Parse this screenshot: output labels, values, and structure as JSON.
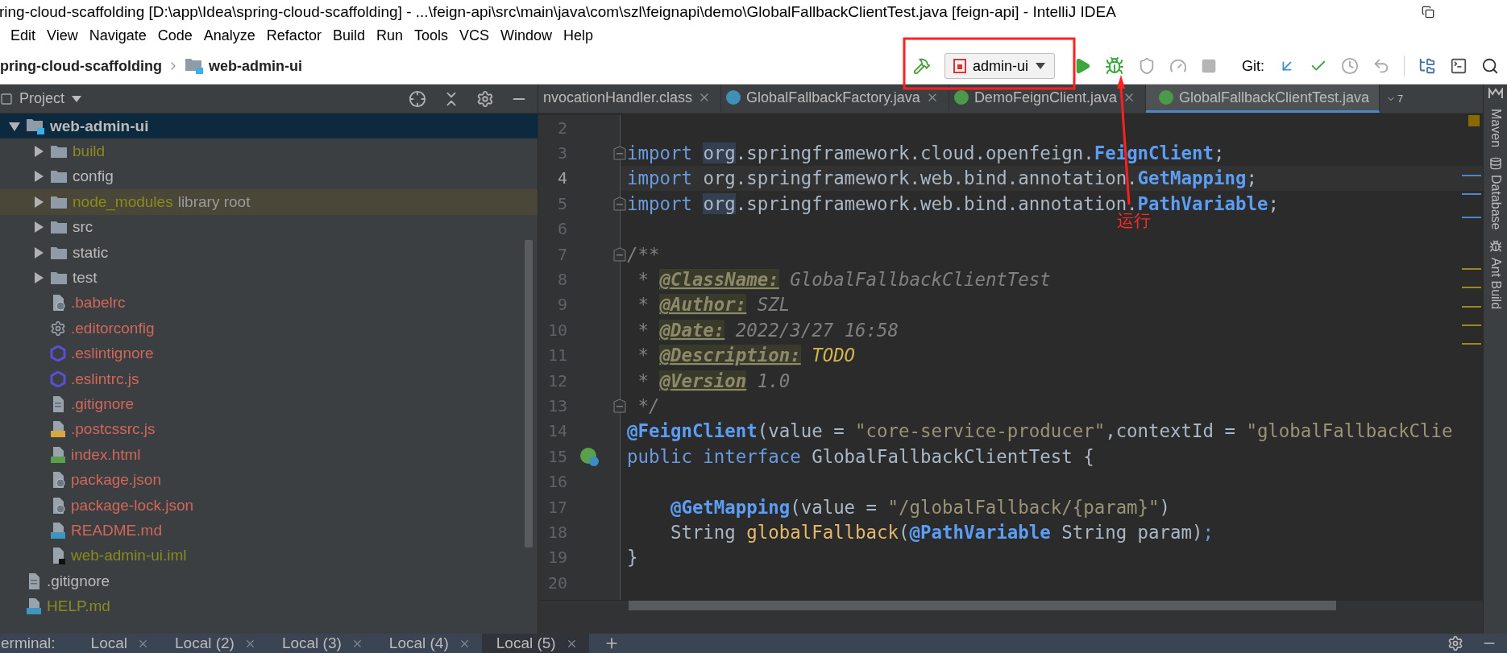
{
  "window": {
    "title": "ring-cloud-scaffolding [D:\\app\\Idea\\spring-cloud-scaffolding] - ...\\feign-api\\src\\main\\java\\com\\szl\\feignapi\\demo\\GlobalFallbackClientTest.java [feign-api] - IntelliJ IDEA"
  },
  "menu": [
    "Edit",
    "View",
    "Navigate",
    "Code",
    "Analyze",
    "Refactor",
    "Build",
    "Run",
    "Tools",
    "VCS",
    "Window",
    "Help"
  ],
  "breadcrumbs": [
    "pring-cloud-scaffolding",
    "web-admin-ui"
  ],
  "run_config": {
    "label": "admin-ui"
  },
  "git_label": "Git:",
  "project_panel": {
    "title": "Project"
  },
  "tree": [
    {
      "label": "web-admin-ui",
      "kind": "module",
      "expanded": true,
      "selected": true,
      "highlighted": false,
      "ignored": false,
      "unversioned": false,
      "children": [
        {
          "label": "build",
          "kind": "folder",
          "expanded": false,
          "selected": false,
          "highlighted": false,
          "ignored": true,
          "unversioned": false
        },
        {
          "label": "config",
          "kind": "folder",
          "expanded": false,
          "selected": false,
          "highlighted": false,
          "ignored": false,
          "unversioned": false
        },
        {
          "label": "node_modules",
          "kind": "folder",
          "expanded": false,
          "selected": false,
          "highlighted": true,
          "ignored": true,
          "unversioned": false,
          "note": "library root"
        },
        {
          "label": "src",
          "kind": "folder",
          "expanded": false,
          "selected": false,
          "highlighted": false,
          "ignored": false,
          "unversioned": false
        },
        {
          "label": "static",
          "kind": "folder",
          "expanded": false,
          "selected": false,
          "highlighted": false,
          "ignored": false,
          "unversioned": false
        },
        {
          "label": "test",
          "kind": "folder",
          "expanded": false,
          "selected": false,
          "highlighted": false,
          "ignored": false,
          "unversioned": false
        },
        {
          "label": ".babelrc",
          "kind": "json",
          "selected": false,
          "highlighted": false,
          "ignored": false,
          "unversioned": true
        },
        {
          "label": ".editorconfig",
          "kind": "config",
          "selected": false,
          "highlighted": false,
          "ignored": false,
          "unversioned": true
        },
        {
          "label": ".eslintignore",
          "kind": "eslint",
          "selected": false,
          "highlighted": false,
          "ignored": false,
          "unversioned": true
        },
        {
          "label": ".eslintrc.js",
          "kind": "eslint",
          "selected": false,
          "highlighted": false,
          "ignored": false,
          "unversioned": true
        },
        {
          "label": ".gitignore",
          "kind": "text",
          "selected": false,
          "highlighted": false,
          "ignored": false,
          "unversioned": true
        },
        {
          "label": ".postcssrc.js",
          "kind": "js",
          "selected": false,
          "highlighted": false,
          "ignored": false,
          "unversioned": true
        },
        {
          "label": "index.html",
          "kind": "html",
          "selected": false,
          "highlighted": false,
          "ignored": false,
          "unversioned": true
        },
        {
          "label": "package.json",
          "kind": "json",
          "selected": false,
          "highlighted": false,
          "ignored": false,
          "unversioned": true
        },
        {
          "label": "package-lock.json",
          "kind": "json",
          "selected": false,
          "highlighted": false,
          "ignored": false,
          "unversioned": true
        },
        {
          "label": "README.md",
          "kind": "md",
          "selected": false,
          "highlighted": false,
          "ignored": false,
          "unversioned": true
        },
        {
          "label": "web-admin-ui.iml",
          "kind": "iml",
          "selected": false,
          "highlighted": false,
          "ignored": true,
          "unversioned": false
        }
      ]
    },
    {
      "label": ".gitignore",
      "kind": "text",
      "selected": false,
      "highlighted": false,
      "ignored": false,
      "unversioned": false
    },
    {
      "label": "HELP.md",
      "kind": "md",
      "selected": false,
      "highlighted": false,
      "ignored": true,
      "unversioned": false
    }
  ],
  "editor_tabs": [
    {
      "label": "nvocationHandler.class",
      "kind": "plain",
      "selected": false,
      "closable": true
    },
    {
      "label": "GlobalFallbackFactory.java",
      "kind": "class",
      "selected": false,
      "closable": true
    },
    {
      "label": "DemoFeignClient.java",
      "kind": "interface",
      "selected": false,
      "closable": true
    },
    {
      "label": "GlobalFallbackClientTest.java",
      "kind": "interface",
      "selected": true,
      "closable": false
    }
  ],
  "tabs_overflow": "7",
  "code_lines": [
    {
      "number": "2",
      "current": false,
      "fold": false,
      "gutter_icon": false
    },
    {
      "number": "3",
      "current": false,
      "fold": true,
      "gutter_icon": false,
      "tokens": [
        {
          "kind": "keyword",
          "text": "import "
        },
        {
          "kind": "reference",
          "text": "org"
        },
        {
          "kind": "plain",
          "text": ".springframework.cloud.openfeign."
        },
        {
          "kind": "annotation",
          "text": "FeignClient"
        },
        {
          "kind": "plain",
          "text": ";"
        }
      ]
    },
    {
      "number": "4",
      "current": true,
      "fold": false,
      "gutter_icon": false,
      "tokens": [
        {
          "kind": "keyword",
          "text": "import "
        },
        {
          "kind": "plain",
          "text": "org.springframework.web.bind.annotation."
        },
        {
          "kind": "annotation",
          "text": "GetMapping"
        },
        {
          "kind": "plain",
          "text": ";"
        }
      ]
    },
    {
      "number": "5",
      "current": false,
      "fold": true,
      "gutter_icon": false,
      "tokens": [
        {
          "kind": "keyword",
          "text": "import "
        },
        {
          "kind": "reference",
          "text": "org"
        },
        {
          "kind": "plain",
          "text": ".springframework.web.bind.annotation."
        },
        {
          "kind": "annotation",
          "text": "PathVariable"
        },
        {
          "kind": "plain",
          "text": ";"
        }
      ]
    },
    {
      "number": "6",
      "current": false,
      "fold": false,
      "gutter_icon": false
    },
    {
      "number": "7",
      "current": false,
      "fold": true,
      "gutter_icon": false,
      "tokens": [
        {
          "kind": "comment",
          "text": "/**"
        }
      ]
    },
    {
      "number": "8",
      "current": false,
      "fold": false,
      "gutter_icon": false,
      "tokens": [
        {
          "kind": "comment",
          "text": " * "
        },
        {
          "kind": "doctag",
          "text": "@ClassName:"
        },
        {
          "kind": "comment",
          "text": " GlobalFallbackClientTest"
        }
      ]
    },
    {
      "number": "9",
      "current": false,
      "fold": false,
      "gutter_icon": false,
      "tokens": [
        {
          "kind": "comment",
          "text": " * "
        },
        {
          "kind": "doctag",
          "text": "@Author:"
        },
        {
          "kind": "comment",
          "text": " SZL"
        }
      ]
    },
    {
      "number": "10",
      "current": false,
      "fold": false,
      "gutter_icon": false,
      "tokens": [
        {
          "kind": "comment",
          "text": " * "
        },
        {
          "kind": "doctag",
          "text": "@Date:"
        },
        {
          "kind": "comment",
          "text": " 2022/3/27 16:58"
        }
      ]
    },
    {
      "number": "11",
      "current": false,
      "fold": false,
      "gutter_icon": false,
      "tokens": [
        {
          "kind": "comment",
          "text": " * "
        },
        {
          "kind": "doctag",
          "text": "@Description:"
        },
        {
          "kind": "todo",
          "text": " TODO"
        }
      ]
    },
    {
      "number": "12",
      "current": false,
      "fold": false,
      "gutter_icon": false,
      "tokens": [
        {
          "kind": "comment",
          "text": " * "
        },
        {
          "kind": "doctag",
          "text": "@Version"
        },
        {
          "kind": "comment",
          "text": " 1.0"
        }
      ]
    },
    {
      "number": "13",
      "current": false,
      "fold": true,
      "gutter_icon": false,
      "tokens": [
        {
          "kind": "comment",
          "text": " */"
        }
      ]
    },
    {
      "number": "14",
      "current": false,
      "fold": false,
      "gutter_icon": false,
      "tokens": [
        {
          "kind": "annotation",
          "text": "@FeignClient"
        },
        {
          "kind": "plain",
          "text": "(value = "
        },
        {
          "kind": "string",
          "text": "\"core-service-producer\""
        },
        {
          "kind": "plain",
          "text": ",contextId = "
        },
        {
          "kind": "string",
          "text": "\"globalFallbackClie"
        }
      ]
    },
    {
      "number": "15",
      "current": false,
      "fold": false,
      "gutter_icon": true,
      "tokens": [
        {
          "kind": "keyword",
          "text": "public interface "
        },
        {
          "kind": "plain",
          "text": "GlobalFallbackClientTest {"
        }
      ]
    },
    {
      "number": "16",
      "current": false,
      "fold": false,
      "gutter_icon": false
    },
    {
      "number": "17",
      "current": false,
      "fold": false,
      "gutter_icon": false,
      "tokens": [
        {
          "kind": "annotation",
          "text": "    @GetMapping"
        },
        {
          "kind": "plain",
          "text": "(value = "
        },
        {
          "kind": "string",
          "text": "\"/globalFallback/{param}\""
        },
        {
          "kind": "plain",
          "text": ")"
        }
      ]
    },
    {
      "number": "18",
      "current": false,
      "fold": false,
      "gutter_icon": false,
      "tokens": [
        {
          "kind": "plain",
          "text": "    String "
        },
        {
          "kind": "method",
          "text": "globalFallback"
        },
        {
          "kind": "plain",
          "text": "("
        },
        {
          "kind": "annotation",
          "text": "@PathVariable"
        },
        {
          "kind": "plain",
          "text": " String param)"
        },
        {
          "kind": "keyword",
          "text": ";"
        }
      ]
    },
    {
      "number": "19",
      "current": false,
      "fold": false,
      "gutter_icon": false,
      "tokens": [
        {
          "kind": "plain",
          "text": "}"
        }
      ]
    },
    {
      "number": "20",
      "current": false,
      "fold": false,
      "gutter_icon": false
    }
  ],
  "side_tools": [
    {
      "label": "Maven",
      "kind": "maven"
    },
    {
      "label": "Database",
      "kind": "database"
    },
    {
      "label": "Ant Build",
      "kind": "ant"
    }
  ],
  "terminal": {
    "label": "erminal:",
    "tabs": [
      {
        "label": "Local",
        "selected": false
      },
      {
        "label": "Local (2)",
        "selected": false
      },
      {
        "label": "Local (3)",
        "selected": false
      },
      {
        "label": "Local (4)",
        "selected": false
      },
      {
        "label": "Local (5)",
        "selected": true
      }
    ]
  },
  "annotation": {
    "label": "运行"
  }
}
